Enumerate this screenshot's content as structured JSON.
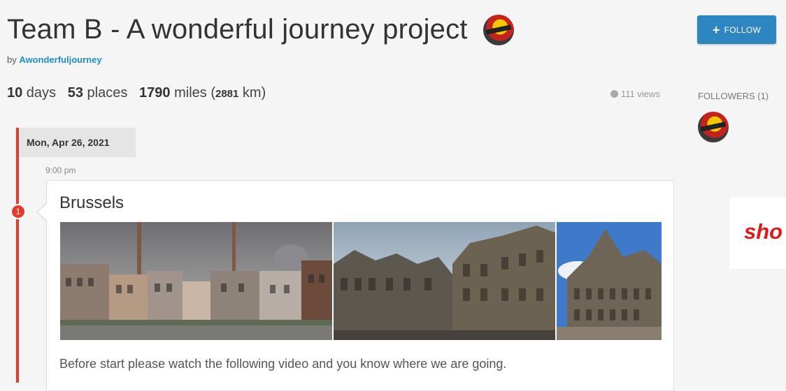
{
  "trip": {
    "title": "Team B - A wonderful journey project",
    "by_prefix": "by ",
    "author": "Awonderfuljourney"
  },
  "stats": {
    "days_num": "10",
    "days_label": " days",
    "places_num": "53",
    "places_label": " places",
    "miles_num": "1790",
    "miles_label": " miles (",
    "km_num": "2881",
    "km_label": " km)"
  },
  "views": "111 views",
  "follow": {
    "label": "FOLLOW"
  },
  "followers": {
    "label": "FOLLOWERS (1)"
  },
  "timeline": {
    "date": "Mon, Apr 26, 2021",
    "entry": {
      "time": "9:00 pm",
      "index": "1",
      "place": "Brussels",
      "description": "Before start please watch the following video and you know where we are going."
    }
  },
  "overlay": {
    "text": "sho"
  },
  "icons": [
    "plus-icon",
    "eye-icon",
    "trip-avatar",
    "follower-avatar",
    "timeline-pin"
  ],
  "colors": {
    "accent": "#2e86c1",
    "link": "#1b8ec4",
    "timeline": "#e53b2c",
    "overlay_text": "#e0191b"
  }
}
